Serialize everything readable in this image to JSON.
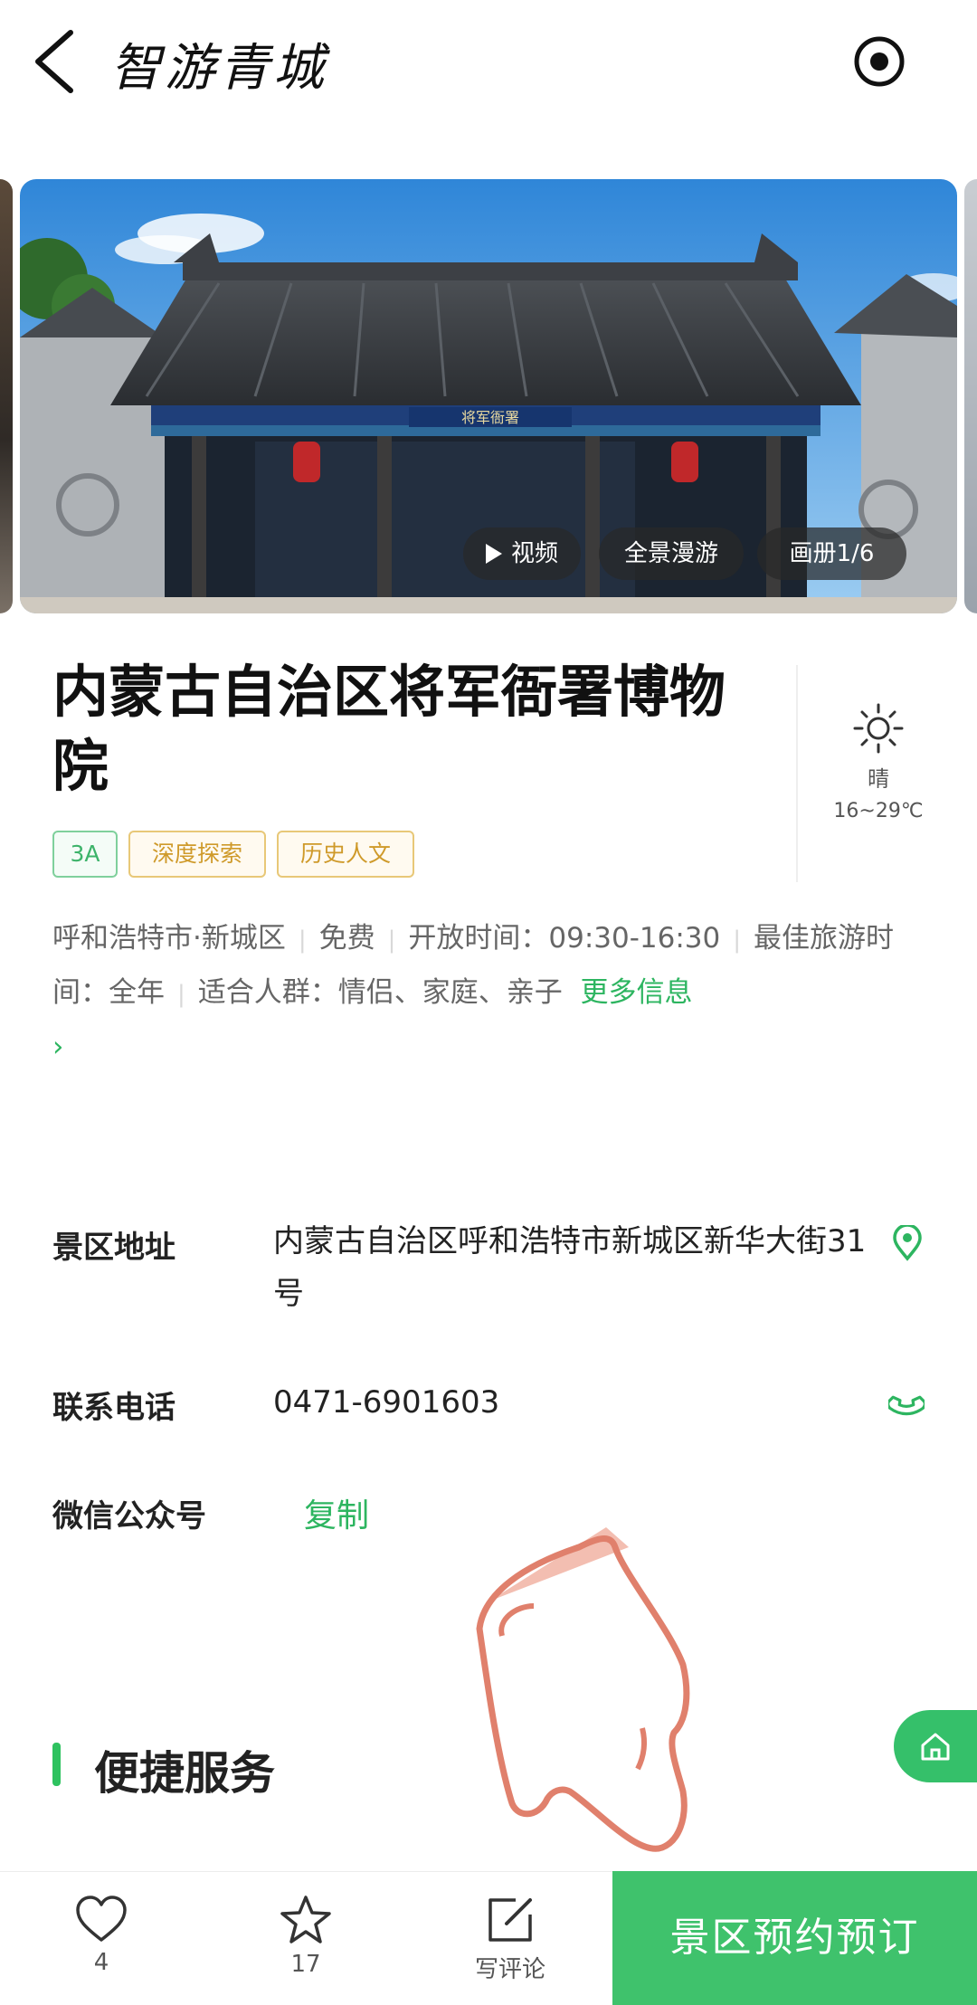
{
  "header": {
    "app_title": "智游青城"
  },
  "gallery": {
    "video_label": "视频",
    "panorama_label": "全景漫游",
    "album_label": "画册1/6",
    "gate_plaque": "将军衙署"
  },
  "place": {
    "title": "内蒙古自治区将军衙署博物院",
    "weather": {
      "condition": "晴",
      "temperature": "16~29℃"
    },
    "tags": [
      "3A",
      "深度探索",
      "历史人文"
    ]
  },
  "info": {
    "location": "呼和浩特市·新城区",
    "price": "免费",
    "open_label": "开放时间：",
    "open_hours": "09:30-16:30",
    "best_label": "最佳旅游时间：",
    "best_time": "全年",
    "crowd_label": "适合人群：",
    "crowd": "情侣、家庭、亲子",
    "more_link": "更多信息",
    "more_chevron": "›"
  },
  "details": {
    "address_label": "景区地址",
    "address": "内蒙古自治区呼和浩特市新城区新华大街31号",
    "phone_label": "联系电话",
    "phone": "0471-6901603",
    "wechat_label": "微信公众号",
    "wechat_copy": "复制"
  },
  "section": {
    "title": "便捷服务"
  },
  "bottom_bar": {
    "like_count": "4",
    "fav_count": "17",
    "review_label": "写评论",
    "book_label": "景区预约预订"
  },
  "colors": {
    "accent_green": "#2db560",
    "button_green": "#3fc26c",
    "tag_gold": "#cf9a2a"
  }
}
